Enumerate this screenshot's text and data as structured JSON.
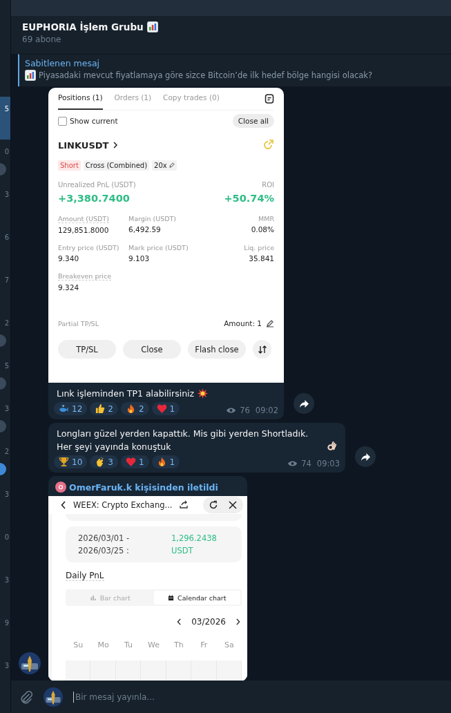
{
  "chat_list": [
    {
      "text": "5",
      "selected": true
    },
    {
      "text": "0",
      "selected": false,
      "badge": {
        "kind": "muted"
      }
    },
    {
      "text": "3",
      "selected": false
    },
    {
      "text": "6",
      "selected": false
    },
    {
      "text": "7",
      "selected": false
    },
    {
      "text": "2",
      "selected": false,
      "badge": {
        "kind": "muted"
      }
    },
    {
      "text": "5",
      "selected": false,
      "badge": {
        "kind": "muted"
      }
    },
    {
      "text": "3",
      "selected": false,
      "badge": {
        "kind": "muted"
      }
    },
    {
      "text": "2",
      "selected": false,
      "badge": {
        "kind": "active"
      }
    },
    {
      "text": "3",
      "selected": false
    },
    {
      "text": "0",
      "selected": false
    },
    {
      "text": "3",
      "selected": false
    },
    {
      "text": "9",
      "selected": false
    },
    {
      "text": "3",
      "selected": false
    }
  ],
  "header": {
    "title": "EUPHORIA İşlem Grubu",
    "subtitle": "69 abone"
  },
  "pinned": {
    "label": "Sabitlenen mesaj",
    "text": "Piyasadaki mevcut fiyatlamaya göre sizce Bitcoin’de ilk hedef bölge hangisi olacak?"
  },
  "messages": [
    {
      "kind": "positions",
      "screenshot": {
        "tabs": [
          {
            "label": "Positions (1)",
            "selected": true
          },
          {
            "label": "Orders (1)",
            "selected": false
          },
          {
            "label": "Copy trades (0)",
            "selected": false
          }
        ],
        "show_current": {
          "label": "Show current",
          "checked": false
        },
        "close_all": "Close all",
        "symbol": "LINKUSDT",
        "tags": [
          {
            "label": "Short",
            "kind": "side"
          },
          {
            "label": "Cross (Combined)",
            "kind": "plain"
          },
          {
            "label": "20x",
            "kind": "edit"
          }
        ],
        "pnl": {
          "label": "Unrealized PnL (USDT)",
          "value": "+3,380.7400",
          "roi_label": "ROI",
          "roi": "+50.74%"
        },
        "fields": [
          {
            "label": "Amount (USDT)",
            "value": "129,851.8000"
          },
          {
            "label": "Margin (USDT)",
            "value": "6,492.59"
          },
          {
            "label": "MMR",
            "value": "0.08%"
          },
          {
            "label": "Entry price (USDT)",
            "value": "9.340"
          },
          {
            "label": "Mark price (USDT)",
            "value": "9.103"
          },
          {
            "label": "Liq. price",
            "value": "35.841"
          },
          {
            "label": "Breakeven price",
            "value": "9.324"
          }
        ],
        "partial": {
          "label": "Partial TP/SL",
          "amount": "Amount: 1"
        },
        "buttons": [
          "TP/SL",
          "Close",
          "Flash close"
        ]
      },
      "text": "Lınk işleminden TP1 alabilirsiniz",
      "text_icon": {
        "kind": "boom"
      },
      "reactions": [
        {
          "kind": "whale",
          "count": "12"
        },
        {
          "kind": "thumbs",
          "count": "2"
        },
        {
          "kind": "fire",
          "count": "2"
        },
        {
          "kind": "heart",
          "count": "1"
        }
      ],
      "views": "76",
      "time": "09:02"
    },
    {
      "kind": "text",
      "text": "Longları güzel yerden kapattık. Mis gibi yerden Shortladık. Her şeyi yayında konuştuk",
      "text_icon": {
        "kind": "ok"
      },
      "reactions": [
        {
          "kind": "trophy",
          "count": "10"
        },
        {
          "kind": "clap",
          "count": "3"
        },
        {
          "kind": "heart",
          "count": "1"
        },
        {
          "kind": "fire",
          "count": "1"
        }
      ],
      "views": "74",
      "time": "09:03"
    },
    {
      "kind": "forwarded",
      "forwarded_from": "OmerFaruk.k kişisinden iletildi",
      "screenshot": {
        "title": "WEEX: Crypto Exchang...",
        "range": "2026/03/01 - 2026/03/25 :",
        "amount": "1,296.2438 USDT",
        "section": "Daily PnL",
        "views": [
          {
            "label": "Bar chart",
            "kind": "bar",
            "selected": false
          },
          {
            "label": "Calendar chart",
            "kind": "calendar",
            "selected": true
          }
        ],
        "month": "03/2026",
        "weekdays": [
          "Su",
          "Mo",
          "Tu",
          "We",
          "Th",
          "Fr",
          "Sa"
        ]
      }
    }
  ],
  "composer": {
    "placeholder": "Bir mesaj yayınla..."
  }
}
